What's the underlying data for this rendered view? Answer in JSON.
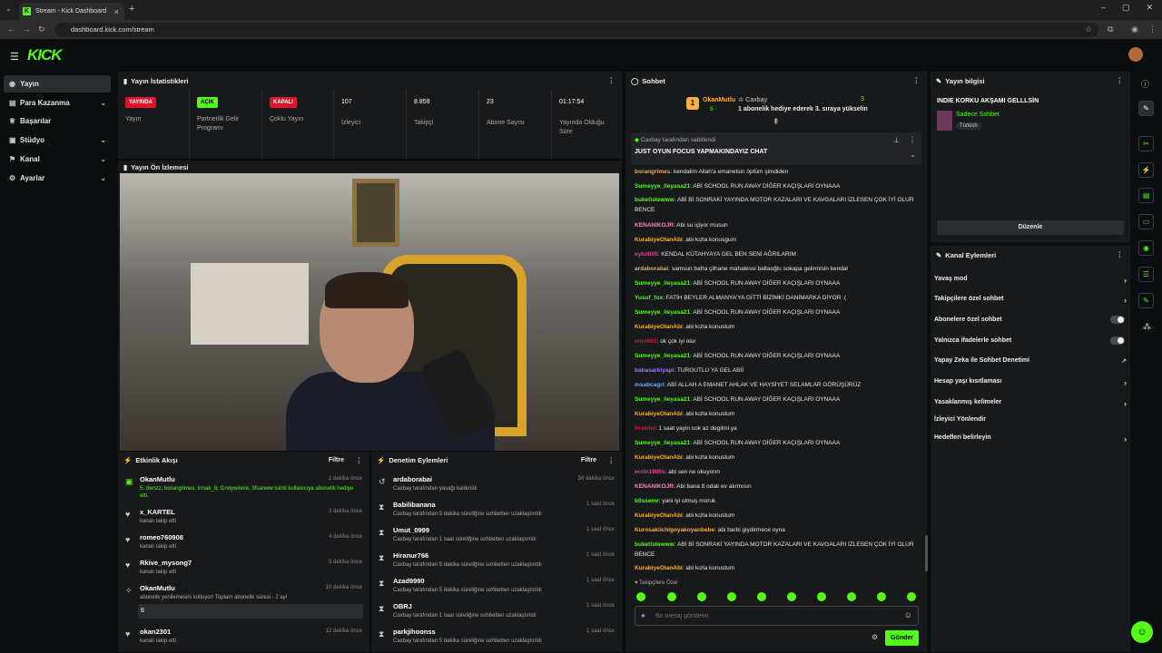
{
  "browser": {
    "tab_title": "Stream - Kick Dashboard",
    "url": "dashboard.kick.com/stream"
  },
  "brand": {
    "logo": "KICK",
    "accent": "#53fc18"
  },
  "sidebar": {
    "items": [
      {
        "label": "Yayın",
        "icon": "broadcast-icon"
      },
      {
        "label": "Para Kazanma",
        "icon": "money-icon"
      },
      {
        "label": "Başarılar",
        "icon": "trophy-icon"
      },
      {
        "label": "Stüdyo",
        "icon": "studio-icon"
      },
      {
        "label": "Kanal",
        "icon": "flag-icon"
      },
      {
        "label": "Ayarlar",
        "icon": "gear-icon"
      }
    ]
  },
  "stats": {
    "title": "Yayın İstatistikleri",
    "items": [
      {
        "value": "YAYINDA",
        "label": "Yayın",
        "badge": "red"
      },
      {
        "value": "AÇIK",
        "label": "Partnerlik Gelir Programı",
        "badge": "green"
      },
      {
        "value": "KAPALI",
        "label": "Çoklu Yayın",
        "badge": "red"
      },
      {
        "value": "107",
        "label": "İzleyici"
      },
      {
        "value": "8.859",
        "label": "Takipçi"
      },
      {
        "value": "23",
        "label": "Abone Sayısı"
      },
      {
        "value": "01:17:54",
        "label": "Yayında Olduğu Süre"
      }
    ]
  },
  "preview": {
    "title": "Yayın Ön İzlemesi"
  },
  "activity": {
    "title": "Etkinlik Akışı",
    "filter": "Filtre",
    "rows": [
      {
        "name": "OkanMutlu",
        "sub": "5, dwnzz, borangrimes, lrmak_8, t1nnywinnie, 3fsanww isimli kullanıcıya abonelik hediye etti.",
        "time": "2 dakika önce"
      },
      {
        "name": "x_KARTEL",
        "sub": "kanalı takip etti",
        "time": "3 dakika önce"
      },
      {
        "name": "romeo760908",
        "sub": "kanalı takip etti",
        "time": "4 dakika önce"
      },
      {
        "name": "Rkive_mysong7",
        "sub": "kanalı takip etti",
        "time": "5 dakika önce"
      },
      {
        "name": "OkanMutlu",
        "sub": "abonelik yenilemesini kutluyor! Toplam abonelik süresi - 2 ay!",
        "time": "10 dakika önce",
        "extra": "6"
      },
      {
        "name": "okan2301",
        "sub": "kanalı takip etti",
        "time": "12 dakika önce"
      }
    ]
  },
  "moderation": {
    "title": "Denetim Eylemleri",
    "filter": "Filtre",
    "rows": [
      {
        "name": "ardaborabai",
        "sub": "Caxbay tarafından yasağı kaldırıldı",
        "time": "56 dakika önce"
      },
      {
        "name": "Babilibanana",
        "sub": "Caxbay tarafından 5 dakika süreliğine sohbetten uzaklaştırıldı",
        "time": "1 saat önce"
      },
      {
        "name": "Umut_0999",
        "sub": "Caxbay tarafından 1 saat süreliğine sohbetten uzaklaştırıldı",
        "time": "1 saat önce"
      },
      {
        "name": "Hiranur766",
        "sub": "Caxbay tarafından 5 dakika süreliğine sohbetten uzaklaştırıldı",
        "time": "1 saat önce"
      },
      {
        "name": "Azad9990",
        "sub": "Caxbay tarafından 5 dakika süreliğine sohbetten uzaklaştırıldı",
        "time": "1 saat önce"
      },
      {
        "name": "OBRJ",
        "sub": "Caxbay tarafından 1 saat süreliğine sohbetten uzaklaştırıldı",
        "time": "1 saat önce"
      },
      {
        "name": "parkjihoonss",
        "sub": "Caxbay tarafından 5 dakika süreliğine sohbetten uzaklaştırıldı",
        "time": "1 saat önce"
      }
    ]
  },
  "chat": {
    "title": "Sohbet",
    "top": {
      "rank": "1",
      "user1": "OkanMutlu",
      "count1": "5",
      "user2": "Caxbay",
      "count2": "3",
      "gift_text": "1 abonelik hediye ederek 3. sıraya yükselin"
    },
    "pinned": {
      "by": "Caxbay tarafından sabitlendi",
      "text": "JUST OYUN FOCUS YAPMAKINDAYIZ CHAT"
    },
    "messages": [
      {
        "user": "borangrimes",
        "color": "#e8a96b",
        "text": "kendalim Allah'a emanetsin öptüm şimdiden"
      },
      {
        "user": "Sumeyye_ileyasa21",
        "color": "#53fc18",
        "text": "ABİ SCHOOL RUN AWAY DİĞER KAÇIŞLARI OYNAAA"
      },
      {
        "user": "buketistewww",
        "color": "#53fc18",
        "text": "ABİ Bİ SONRAKİ YAYINDA MOTOR KAZALARI VE KAVGALARI İZLESEN ÇOK İYİ OLUR BENCE"
      },
      {
        "user": "KENANIKOJR",
        "color": "#f28cb1",
        "text": "Abi su içiyor musun"
      },
      {
        "user": "KurabiyeOlanAbi",
        "color": "#f5b041",
        "text": "abi kızla konusgum"
      },
      {
        "user": "eylul005",
        "color": "#e84393",
        "text": "KENDAL KÜTAHYAYA GEL BEN SENİ AĞRILARIM"
      },
      {
        "user": "ardaborabai",
        "color": "#e8a96b",
        "text": "samsun bafra çilhane mahalessi baltaoğlu sokapa gelirmisin kendal"
      },
      {
        "user": "Sumeyye_ileyasa21",
        "color": "#53fc18",
        "text": "ABİ SCHOOL RUN AWAY DİĞER KAÇIŞLARI OYNAAA"
      },
      {
        "user": "Yusuf_fox",
        "color": "#53fc18",
        "text": "FATİH BEYLER ALMANYA'YA GİTTİ BİZİMKİ DANİMARKA DİYOR :("
      },
      {
        "user": "Sumeyye_ileyasa21",
        "color": "#53fc18",
        "text": "ABİ SCHOOL RUN AWAY DİĞER KAÇIŞLARI OYNAAA"
      },
      {
        "user": "KurabiyeOlanAbi",
        "color": "#f5b041",
        "text": "abi kızla konustum"
      },
      {
        "user": "emrl665",
        "color": "#e5112b",
        "text": "ok çok iyi olur"
      },
      {
        "user": "Sumeyye_ileyasa21",
        "color": "#53fc18",
        "text": "ABİ SCHOOL RUN AWAY DİĞER KAÇIŞLARI OYNAAA"
      },
      {
        "user": "babasarkiyapi",
        "color": "#9b7bff",
        "text": "TURGUTLU YA GEL ABİİ"
      },
      {
        "user": "msabcagri",
        "color": "#6ea8ff",
        "text": "ABİ ALLAH A EMANET AHLAK VE HAYSİYET SELAMLAR GÖRÜŞÜRÜZ"
      },
      {
        "user": "Sumeyye_ileyasa21",
        "color": "#53fc18",
        "text": "ABİ SCHOOL RUN AWAY DİĞER KAÇIŞLARI OYNAAA"
      },
      {
        "user": "KurabiyeOlanAbi",
        "color": "#f5b041",
        "text": "abi kızla konustum"
      },
      {
        "user": "fmelme",
        "color": "#e5112b",
        "text": "1 saat yayin cok az degilmi ya"
      },
      {
        "user": "Sumeyye_ileyasa21",
        "color": "#53fc18",
        "text": "ABİ SCHOOL RUN AWAY DİĞER KAÇIŞLARI OYNAAA"
      },
      {
        "user": "KurabiyeOlanAbi",
        "color": "#f5b041",
        "text": "abi kızla konustum"
      },
      {
        "user": "ecrin1905s",
        "color": "#e84393",
        "text": "abi sen ne okuyorın"
      },
      {
        "user": "KENANIKOJR",
        "color": "#f28cb1",
        "text": "Abi bana 8 odak ev alırmısın"
      },
      {
        "user": "b0ssemr",
        "color": "#53fc18",
        "text": "yani iyi olmuş moruk"
      },
      {
        "user": "KurabiyeOlanAbi",
        "color": "#f5b041",
        "text": "abi kızla konustum"
      },
      {
        "user": "Kurosakiichigoyakoyanbebe",
        "color": "#f5b041",
        "text": "abi barbi giydirmece oyna"
      },
      {
        "user": "buketistewww",
        "color": "#53fc18",
        "text": "ABİ Bİ SONRAKİ YAYINDA MOTOR KAZALARI VE KAVGALARI İZLESEN ÇOK İYİ OLUR BENCE"
      },
      {
        "user": "KurabiyeOlanAbi",
        "color": "#f5b041",
        "text": "abi kızla konustum"
      }
    ],
    "followers_only": "Takipçilere Özel",
    "placeholder": "Bir mesaj gönderin",
    "send": "Gönder"
  },
  "stream_info": {
    "title": "Yayın bilgisi",
    "stream_title": "INDIE KORKU AKŞAMI GELLLSİN",
    "category": "Sadece Sohbet",
    "tag": "Türkish",
    "edit": "Düzenle"
  },
  "channel_actions": {
    "title": "Kanal Eylemleri",
    "items": [
      {
        "label": "Yavaş mod",
        "control": "chevron"
      },
      {
        "label": "Takipçilere özel sohbet",
        "control": "chevron"
      },
      {
        "label": "Abonelere özel sohbet",
        "control": "toggle"
      },
      {
        "label": "Yalnızca ifadelerle sohbet",
        "control": "toggle"
      },
      {
        "label": "Yapay Zeka ile Sohbet Denetimi",
        "control": "external"
      },
      {
        "label": "Hesap yaşı kısıtlaması",
        "control": "chevron"
      },
      {
        "label": "Yasaklanmış kelimeler",
        "control": "chevron"
      },
      {
        "label": "İzleyici Yönlendir",
        "control": "none"
      },
      {
        "label": "Hedefleri belirleyin",
        "control": "chevron"
      }
    ]
  }
}
